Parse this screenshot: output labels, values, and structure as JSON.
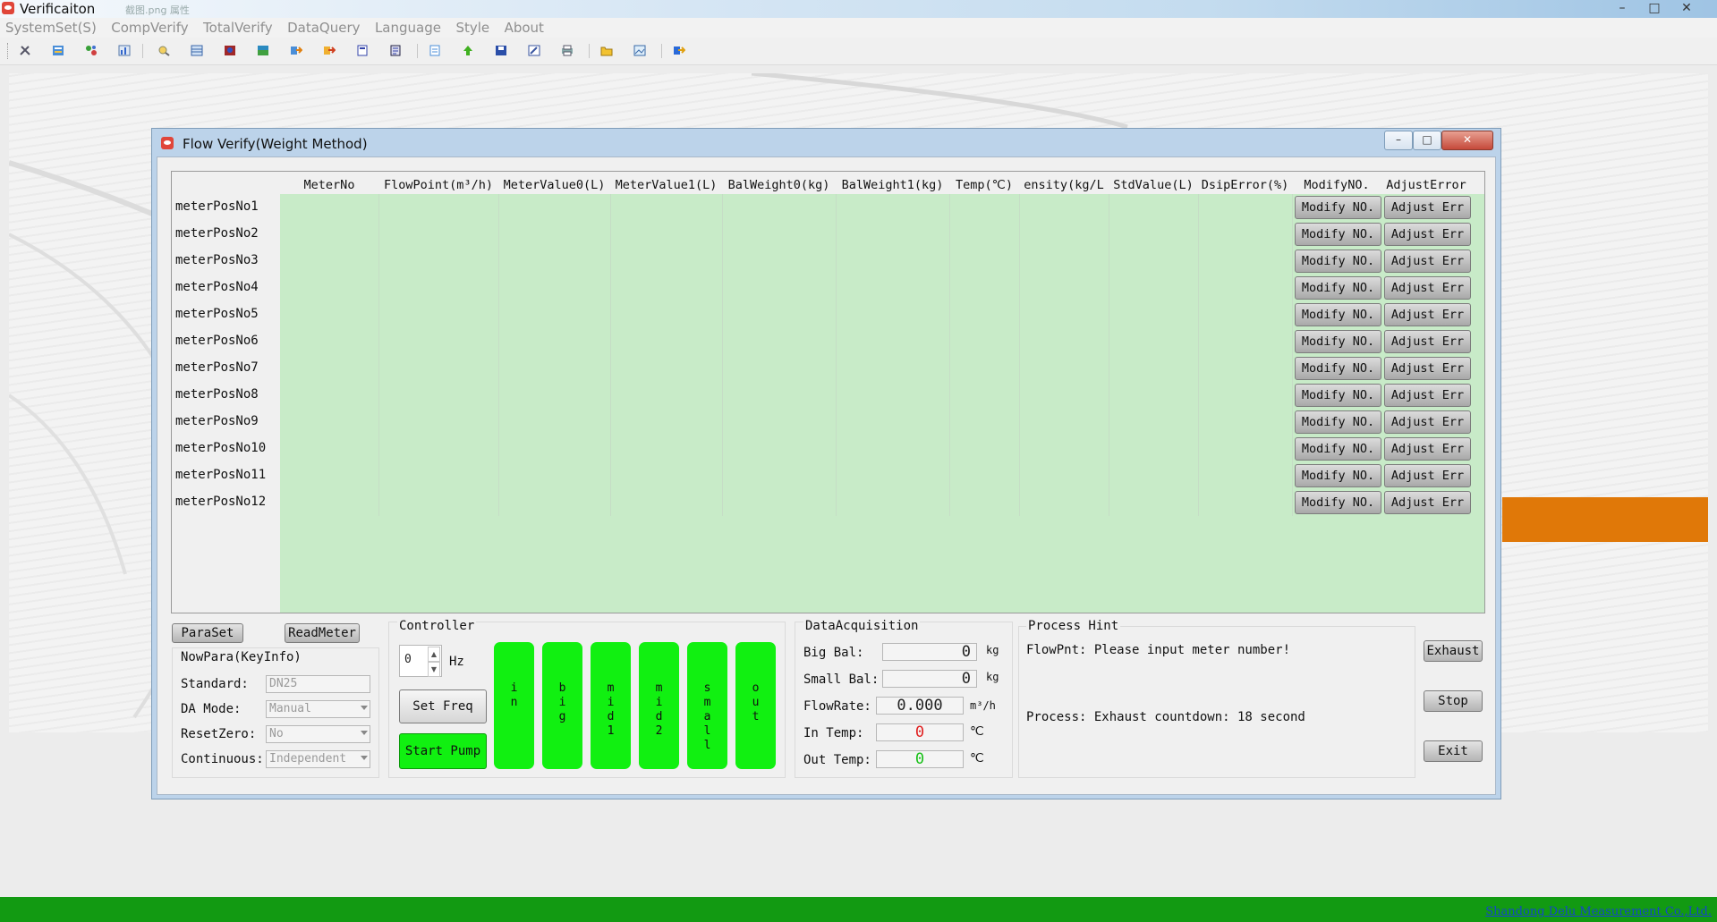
{
  "window": {
    "title": "Verificaiton",
    "ghost_text": "截图.png  属性",
    "buttons": {
      "minimize": "–",
      "maximize": "□",
      "close": "✕"
    }
  },
  "menubar": {
    "items": [
      "SystemSet(S)",
      "CompVerify",
      "TotalVerify",
      "DataQuery",
      "Language",
      "Style",
      "About"
    ]
  },
  "toolbar": {
    "icons": [
      "tools-icon",
      "grid-icon",
      "network-icon",
      "chart-icon",
      "search-icon",
      "table-icon",
      "image-icon",
      "database-icon",
      "arrow-right-icon",
      "arrows-icon",
      "document-icon",
      "report-icon",
      "page-icon",
      "upload-icon",
      "save-icon",
      "edit-icon",
      "printer-icon",
      "folder-icon",
      "picture-icon",
      "export-icon"
    ]
  },
  "dialog": {
    "title": "Flow Verify(Weight Method)",
    "buttons": {
      "minimize": "–",
      "maximize": "□",
      "close": "✕"
    }
  },
  "grid": {
    "columns": [
      "MeterNo",
      "FlowPoint(m³/h)",
      "MeterValue0(L)",
      "MeterValue1(L)",
      "BalWeight0(kg)",
      "BalWeight1(kg)",
      "Temp(℃)",
      "ensity(kg/L",
      "StdValue(L)",
      "DsipError(%)",
      "ModifyNO.",
      "AdjustError"
    ],
    "rows": [
      "meterPosNo1",
      "meterPosNo2",
      "meterPosNo3",
      "meterPosNo4",
      "meterPosNo5",
      "meterPosNo6",
      "meterPosNo7",
      "meterPosNo8",
      "meterPosNo9",
      "meterPosNo10",
      "meterPosNo11",
      "meterPosNo12"
    ],
    "modify_btn_label": "Modify NO.",
    "adjust_btn_label": "Adjust Err"
  },
  "left_panel": {
    "paraset_btn": "ParaSet",
    "readmeter_btn": "ReadMeter",
    "group_title": "NowPara(KeyInfo)",
    "standard_label": "Standard:",
    "standard_value": "DN25",
    "damode_label": "DA Mode:",
    "damode_value": "Manual",
    "resetzero_label": "ResetZero:",
    "resetzero_value": "No",
    "continuous_label": "Continuous:",
    "continuous_value": "Independent"
  },
  "controller": {
    "title": "Controller",
    "freq_value": "0",
    "freq_unit": "Hz",
    "set_freq_btn": "Set Freq",
    "start_pump_btn": "Start Pump",
    "valves": [
      "in",
      "big",
      "mid1",
      "mid2",
      "small",
      "out"
    ]
  },
  "data_acquisition": {
    "title": "DataAcquisition",
    "big_bal_label": "Big Bal:",
    "big_bal_value": "0",
    "big_bal_unit": "kg",
    "small_bal_label": "Small Bal:",
    "small_bal_value": "0",
    "small_bal_unit": "kg",
    "flowrate_label": "FlowRate:",
    "flowrate_value": "0.000",
    "flowrate_unit": "m³/h",
    "in_temp_label": "In Temp:",
    "in_temp_value": "0",
    "in_temp_unit": "℃",
    "out_temp_label": "Out Temp:",
    "out_temp_value": "0",
    "out_temp_unit": "℃",
    "colors": {
      "in_temp": "#e02020",
      "out_temp": "#18c018",
      "default": "#222222"
    }
  },
  "process_hint": {
    "title": "Process Hint",
    "flowpnt_text": "FlowPnt: Please input meter number!",
    "process_text": "Process: Exhaust countdown: 18 second"
  },
  "actions": {
    "exhaust": "Exhaust",
    "stop": "Stop",
    "exit": "Exit"
  },
  "statusbar": {
    "company": "Shandong Delu Measurement Co.,Ltd."
  },
  "colors": {
    "grid_green": "#c8ebc8",
    "valve_green": "#11f011",
    "statusbar_green": "#129a12",
    "accent_orange": "#e07808"
  }
}
